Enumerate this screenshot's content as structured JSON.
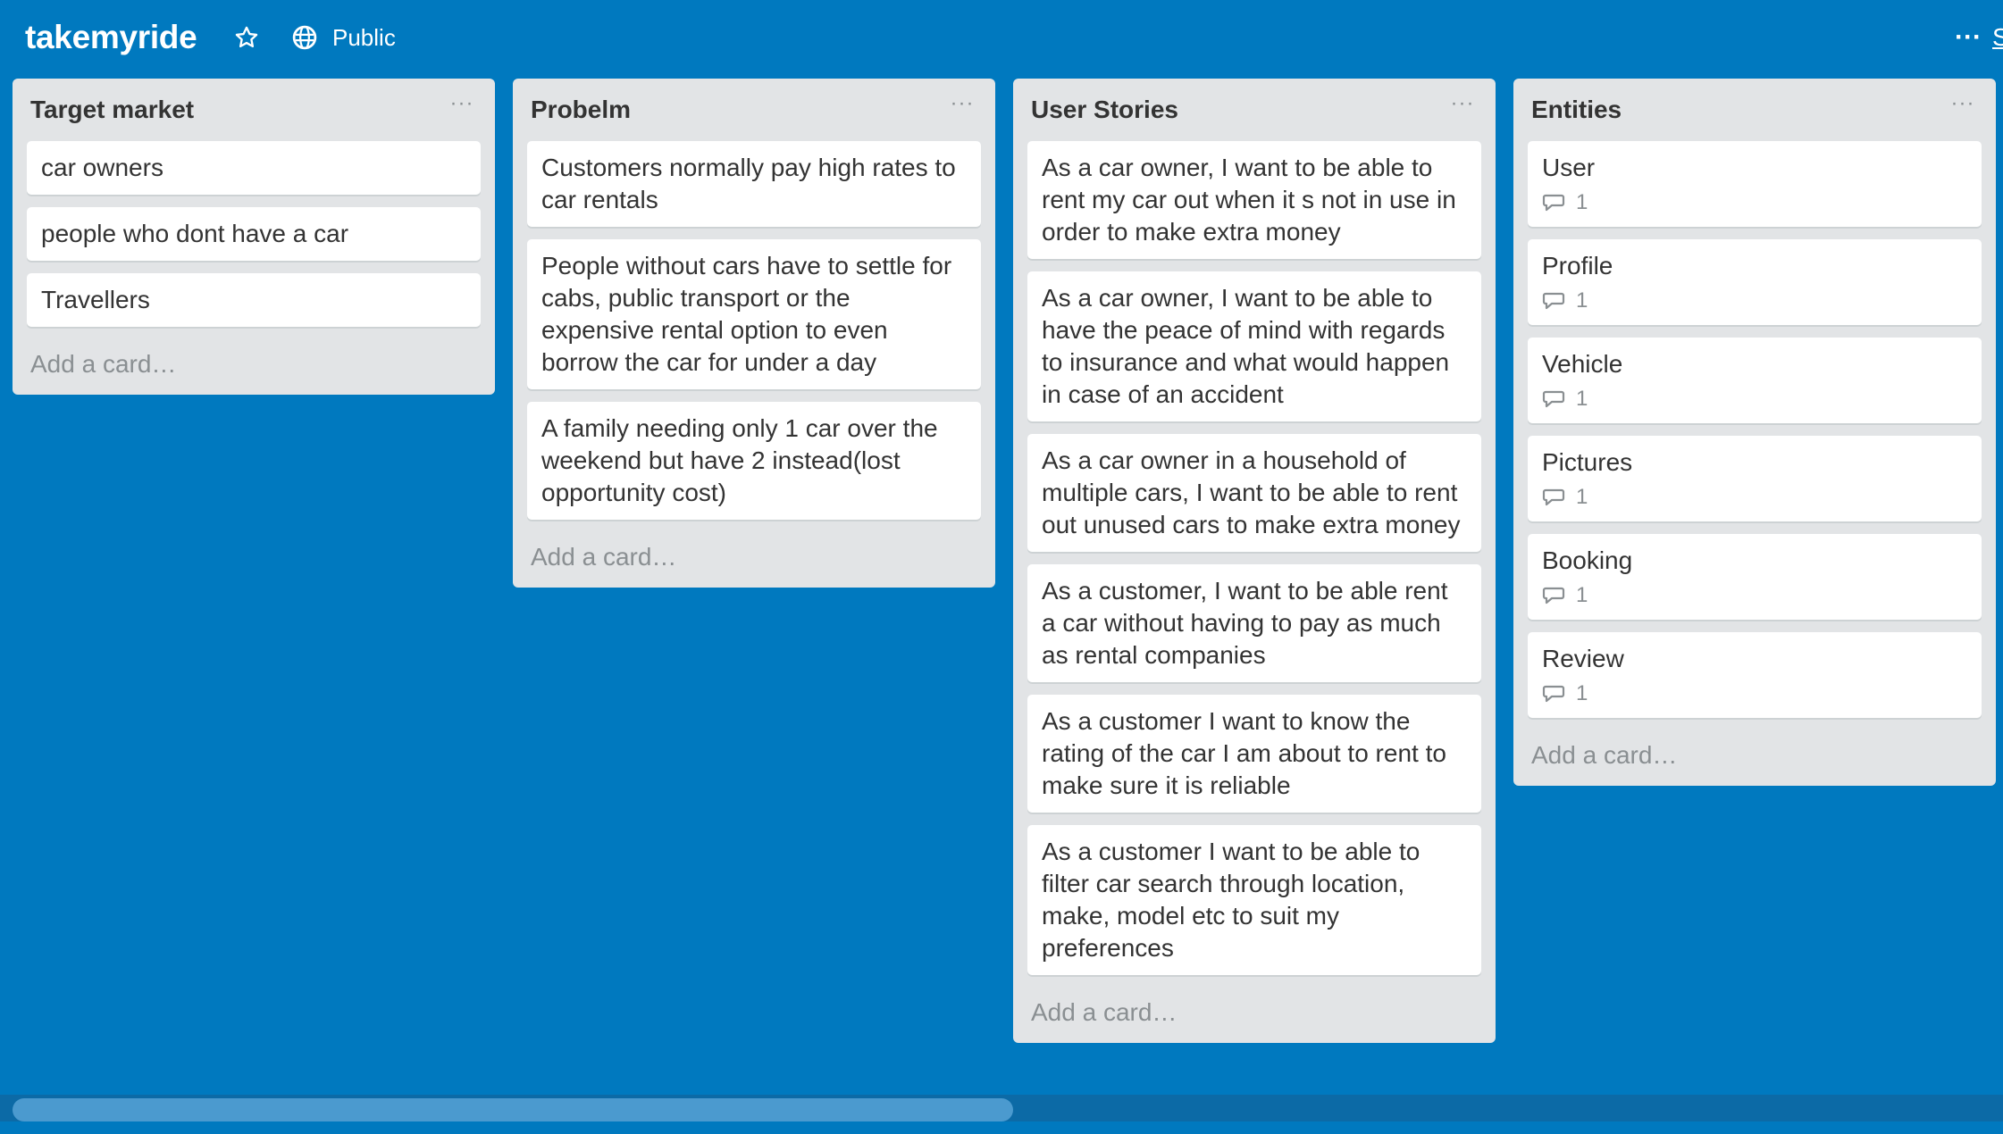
{
  "board": {
    "title": "takemyride",
    "visibility": "Public",
    "more": "···",
    "cut_text": "S"
  },
  "colors": {
    "background": "#0079bf",
    "list_bg": "#e2e4e6",
    "card_bg": "#ffffff",
    "text": "#333333",
    "muted": "#8a8f92"
  },
  "icons": {
    "star": "star-icon",
    "visibility": "globe-icon",
    "comment": "comment-icon"
  },
  "lists": [
    {
      "title": "Target market",
      "menu": "···",
      "add_card": "Add a card…",
      "cards": [
        {
          "text": "car owners"
        },
        {
          "text": "people who dont have a car"
        },
        {
          "text": "Travellers"
        }
      ]
    },
    {
      "title": "Probelm",
      "menu": "···",
      "add_card": "Add a card…",
      "cards": [
        {
          "text": "Customers normally pay high rates to car rentals"
        },
        {
          "text": "People without cars have to settle for cabs, public transport or the expensive rental option to even borrow the car for under a day"
        },
        {
          "text": "A family needing only 1 car over the weekend but have 2 instead(lost opportunity cost)"
        }
      ]
    },
    {
      "title": "User Stories",
      "menu": "···",
      "add_card": "Add a card…",
      "cards": [
        {
          "text": "As a car owner, I want to be able to rent my car out when it s not in use in order to make extra money"
        },
        {
          "text": "As a car owner, I want to be able to have the peace of mind with regards to insurance and what would happen in case of an accident"
        },
        {
          "text": "As a car owner in a household of multiple cars, I want to be able to rent out unused cars to make extra money"
        },
        {
          "text": "As a customer, I want to be able rent a car without having to pay as much as rental companies"
        },
        {
          "text": "As a customer I want to know the rating of the car I am about to rent to make sure it is reliable"
        },
        {
          "text": "As a customer I want to be able to filter car search through location, make, model etc to suit my preferences"
        }
      ]
    },
    {
      "title": "Entities",
      "menu": "···",
      "add_card": "Add a card…",
      "cards": [
        {
          "text": "User",
          "comments": "1"
        },
        {
          "text": "Profile",
          "comments": "1"
        },
        {
          "text": "Vehicle",
          "comments": "1"
        },
        {
          "text": "Pictures",
          "comments": "1"
        },
        {
          "text": "Booking",
          "comments": "1"
        },
        {
          "text": "Review",
          "comments": "1"
        }
      ]
    }
  ],
  "scrollbar": {
    "position_fraction": 0.0,
    "visible_fraction": 0.5
  }
}
